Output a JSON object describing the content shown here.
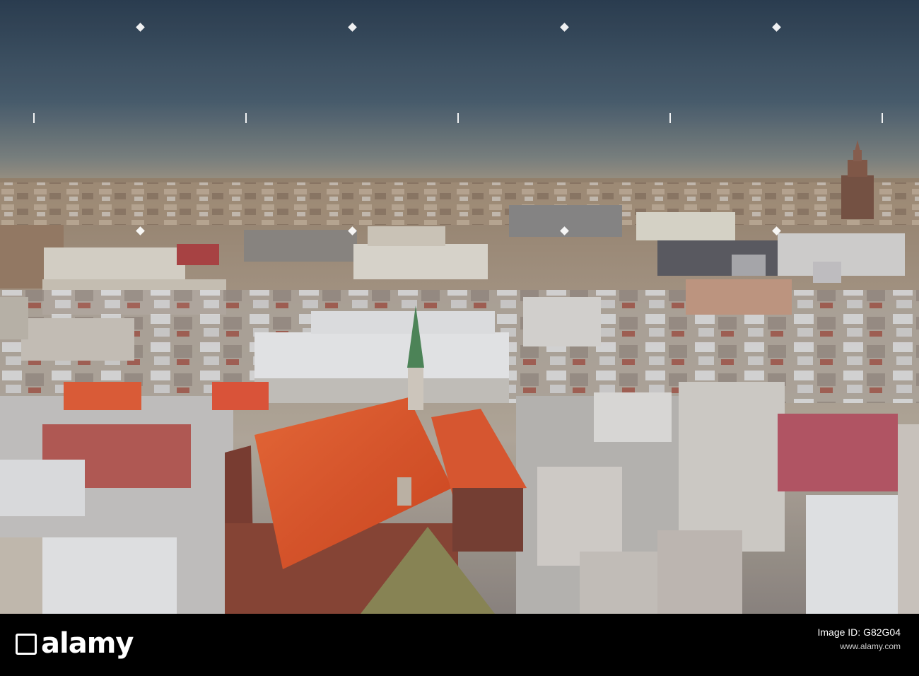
{
  "photo": {
    "subject": "aerial-city-view",
    "palette": {
      "sky_top": "#2c3f52",
      "sky_mid": "#4f6372",
      "sky_horizon": "#a49a86",
      "city_far": "#9d8770",
      "city_mid": "#b8a994",
      "snow_roof": "#e6e8ea",
      "church_roof": "#e0522b",
      "brick": "#8a4a3a",
      "spire": "#4f8a5a"
    }
  },
  "watermark": {
    "brand_mark": "alamy"
  },
  "footer": {
    "logo_text": "alamy",
    "image_id_label": "Image ID: G82G04",
    "site": "www.alamy.com"
  }
}
